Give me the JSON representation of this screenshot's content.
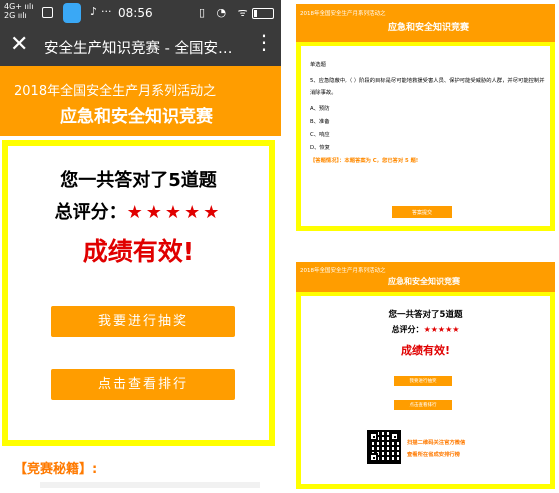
{
  "status_bar": {
    "network_label": "4G+ ıılı 2G ıılı",
    "time": "08:56",
    "dots": "···",
    "right_icons": "▯ ◔ ᯤ"
  },
  "title_bar": {
    "close_glyph": "✕",
    "title": "安全生产知识竞赛 - 全国安…",
    "more_glyph": "⋮"
  },
  "banner": {
    "subtitle": "2018年全国安全生产月系列活动之",
    "title": "应急和安全知识竞赛"
  },
  "result_card": {
    "count_text": "您一共答对了5道题",
    "score_label": "总评分：",
    "stars": "★★★★★",
    "result_text": "成绩有效!",
    "lottery_button": "我要进行抽奖",
    "ranking_button": "点击查看排行"
  },
  "tips": {
    "label": "【竞赛秘籍】:"
  },
  "question_screen": {
    "header_small": "2018年全国安全生产月系列活动之",
    "header_title": "应急和安全知识竞赛",
    "question_type": "单选题",
    "question_line1": "5、应急隐蔽中,（ ）阶段的目标是尽可能地救援受害人员、保护可能受威胁的人群，并尽可能控制并",
    "question_line2": "消除事故。",
    "options": [
      {
        "label": "A、预防"
      },
      {
        "label": "B、准备"
      },
      {
        "label": "C、响应"
      },
      {
        "label": "D、恢复"
      }
    ],
    "answer_text": "【答题情况】：本题答案为 C，您已答对 5 题!",
    "next_button": "答案提交"
  },
  "result_screen": {
    "header_small": "2018年全国安全生产月系列活动之",
    "header_title": "应急和安全知识竞赛",
    "count_text": "您一共答对了5道题",
    "score_label": "总评分：",
    "stars": "★★★★★",
    "result_text": "成绩有效!",
    "lottery_button": "我要进行抽奖",
    "ranking_button": "点击查看排行",
    "qr_line1": "扫描二维码关注官方微信",
    "qr_line2": "查看所在省成安排行榜"
  },
  "colors": {
    "orange": "#ff9d00",
    "yellow": "#ffff00",
    "red": "#e00000",
    "dark_bar": "#3a3a3a"
  }
}
